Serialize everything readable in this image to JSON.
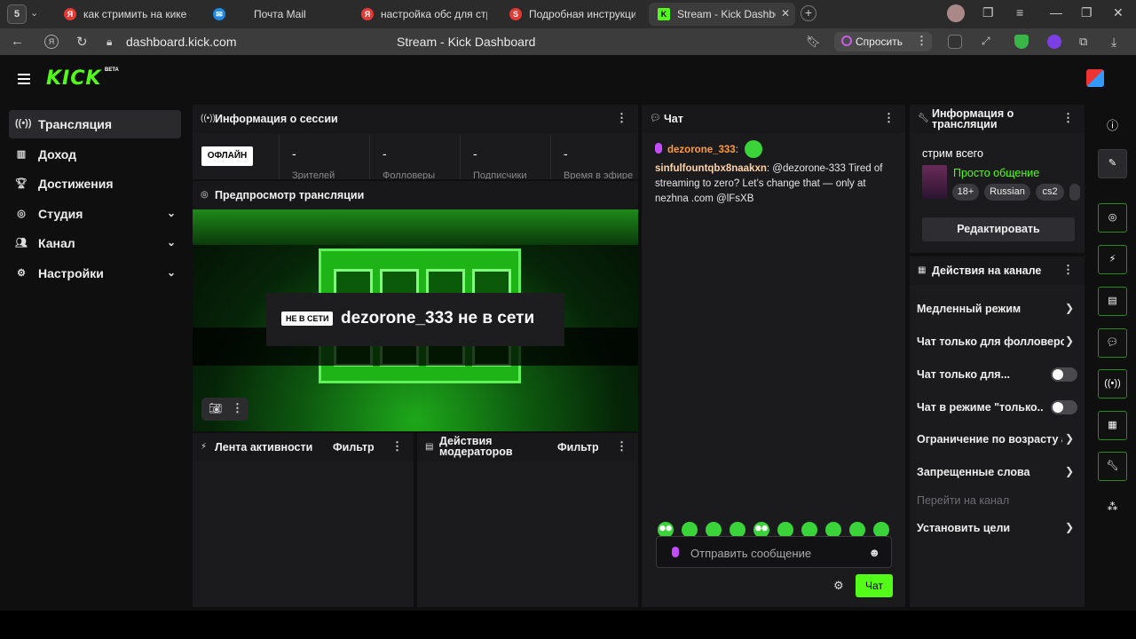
{
  "browser": {
    "tab_count": "5",
    "tabs": [
      {
        "label": "как стримить на кике — Я",
        "favicon": "Я",
        "color": "#e53935"
      },
      {
        "label": "Почта Mail",
        "favicon": "✉",
        "color": "#1e88e5"
      },
      {
        "label": "настройка обс для стрим",
        "favicon": "Я",
        "color": "#e53935"
      },
      {
        "label": "Подробная инструкция: ",
        "favicon": "S",
        "color": "#e53935"
      },
      {
        "label": "Stream - Kick Dashboard",
        "favicon": "K",
        "color": "#53fc18"
      }
    ],
    "url": "dashboard.kick.com",
    "page_title": "Stream - Kick Dashboard",
    "ask_button": "Спросить"
  },
  "header": {
    "logo": "KICK",
    "beta": "BETA"
  },
  "sidebar": {
    "items": [
      {
        "label": "Трансляция",
        "icon": "broadcast-icon"
      },
      {
        "label": "Доход",
        "icon": "bar-chart-icon"
      },
      {
        "label": "Достижения",
        "icon": "trophy-icon"
      },
      {
        "label": "Студия",
        "icon": "camera-icon"
      },
      {
        "label": "Канал",
        "icon": "users-icon"
      },
      {
        "label": "Настройки",
        "icon": "gear-icon"
      }
    ]
  },
  "session": {
    "title": "Информация о сессии",
    "status": "ОФЛАЙН",
    "stats": [
      {
        "value": "-",
        "label": "Зрителей"
      },
      {
        "value": "-",
        "label": "Фолловеры"
      },
      {
        "value": "-",
        "label": "Подписчики"
      },
      {
        "value": "-",
        "label": "Время в эфире"
      }
    ]
  },
  "preview": {
    "title": "Предпросмотр трансляции",
    "offline_tag": "НЕ В СЕТИ",
    "offline_message": "dezorone_333 не в сети"
  },
  "activity": {
    "title": "Лента активности",
    "filter": "Фильтр"
  },
  "mod_actions": {
    "title": "Действия модераторов",
    "filter": "Фильтр"
  },
  "chat": {
    "title": "Чат",
    "messages": [
      {
        "user": "dezorone_333",
        "text": ""
      },
      {
        "user": "sinfulfountqbx8naakxn",
        "text": " @dezorone-333 Tired of streaming to zero? Let’s change that — only at nezhna .com @lFsXB"
      }
    ],
    "placeholder": "Отправить сообщение",
    "send_label": "Чат"
  },
  "stream_info": {
    "title": "Информация о трансляции",
    "stream_title": "стрим всего",
    "category": "Просто общение",
    "tags": [
      "18+",
      "Russian",
      "cs2"
    ],
    "edit_label": "Редактировать"
  },
  "channel_actions": {
    "title": "Действия на канале",
    "items": [
      {
        "label": "Медленный режим",
        "control": "chevron"
      },
      {
        "label": "Чат только для фолловеров",
        "control": "chevron"
      },
      {
        "label": "Чат только для...",
        "control": "toggle"
      },
      {
        "label": "Чат в режиме \"только...",
        "control": "toggle"
      },
      {
        "label": "Ограничение по возрасту аккаунта",
        "control": "chevron"
      },
      {
        "label": "Запрещенные слова",
        "control": "chevron"
      },
      {
        "label": "Перейти на канал",
        "control": "none"
      },
      {
        "label": "Установить цели",
        "control": "chevron"
      }
    ]
  },
  "colors": {
    "brand": "#53fc18",
    "panel": "#1b1b1d",
    "background": "#0f0f10"
  }
}
